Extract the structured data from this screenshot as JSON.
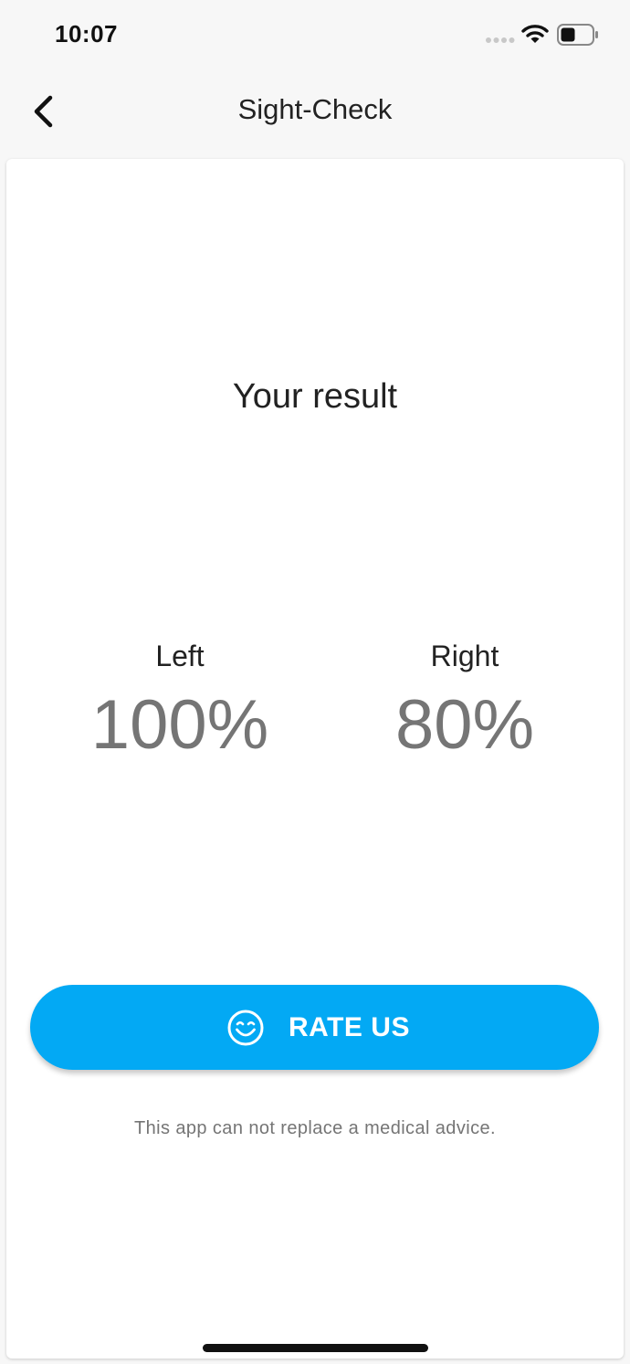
{
  "status_bar": {
    "time": "10:07",
    "icons": [
      "signal-icon",
      "wifi-icon",
      "battery-icon"
    ]
  },
  "nav": {
    "title": "Sight-Check",
    "back_icon": "chevron-left-icon"
  },
  "result": {
    "title": "Your result",
    "left": {
      "label": "Left",
      "value": "100%"
    },
    "right": {
      "label": "Right",
      "value": "80%"
    }
  },
  "rate_button": {
    "label": "RATE US",
    "icon": "smile-icon"
  },
  "disclaimer": "This app can not replace a medical advice.",
  "colors": {
    "accent": "#03a9f4",
    "value_text": "#757575",
    "background": "#f7f7f7",
    "card": "#ffffff"
  }
}
